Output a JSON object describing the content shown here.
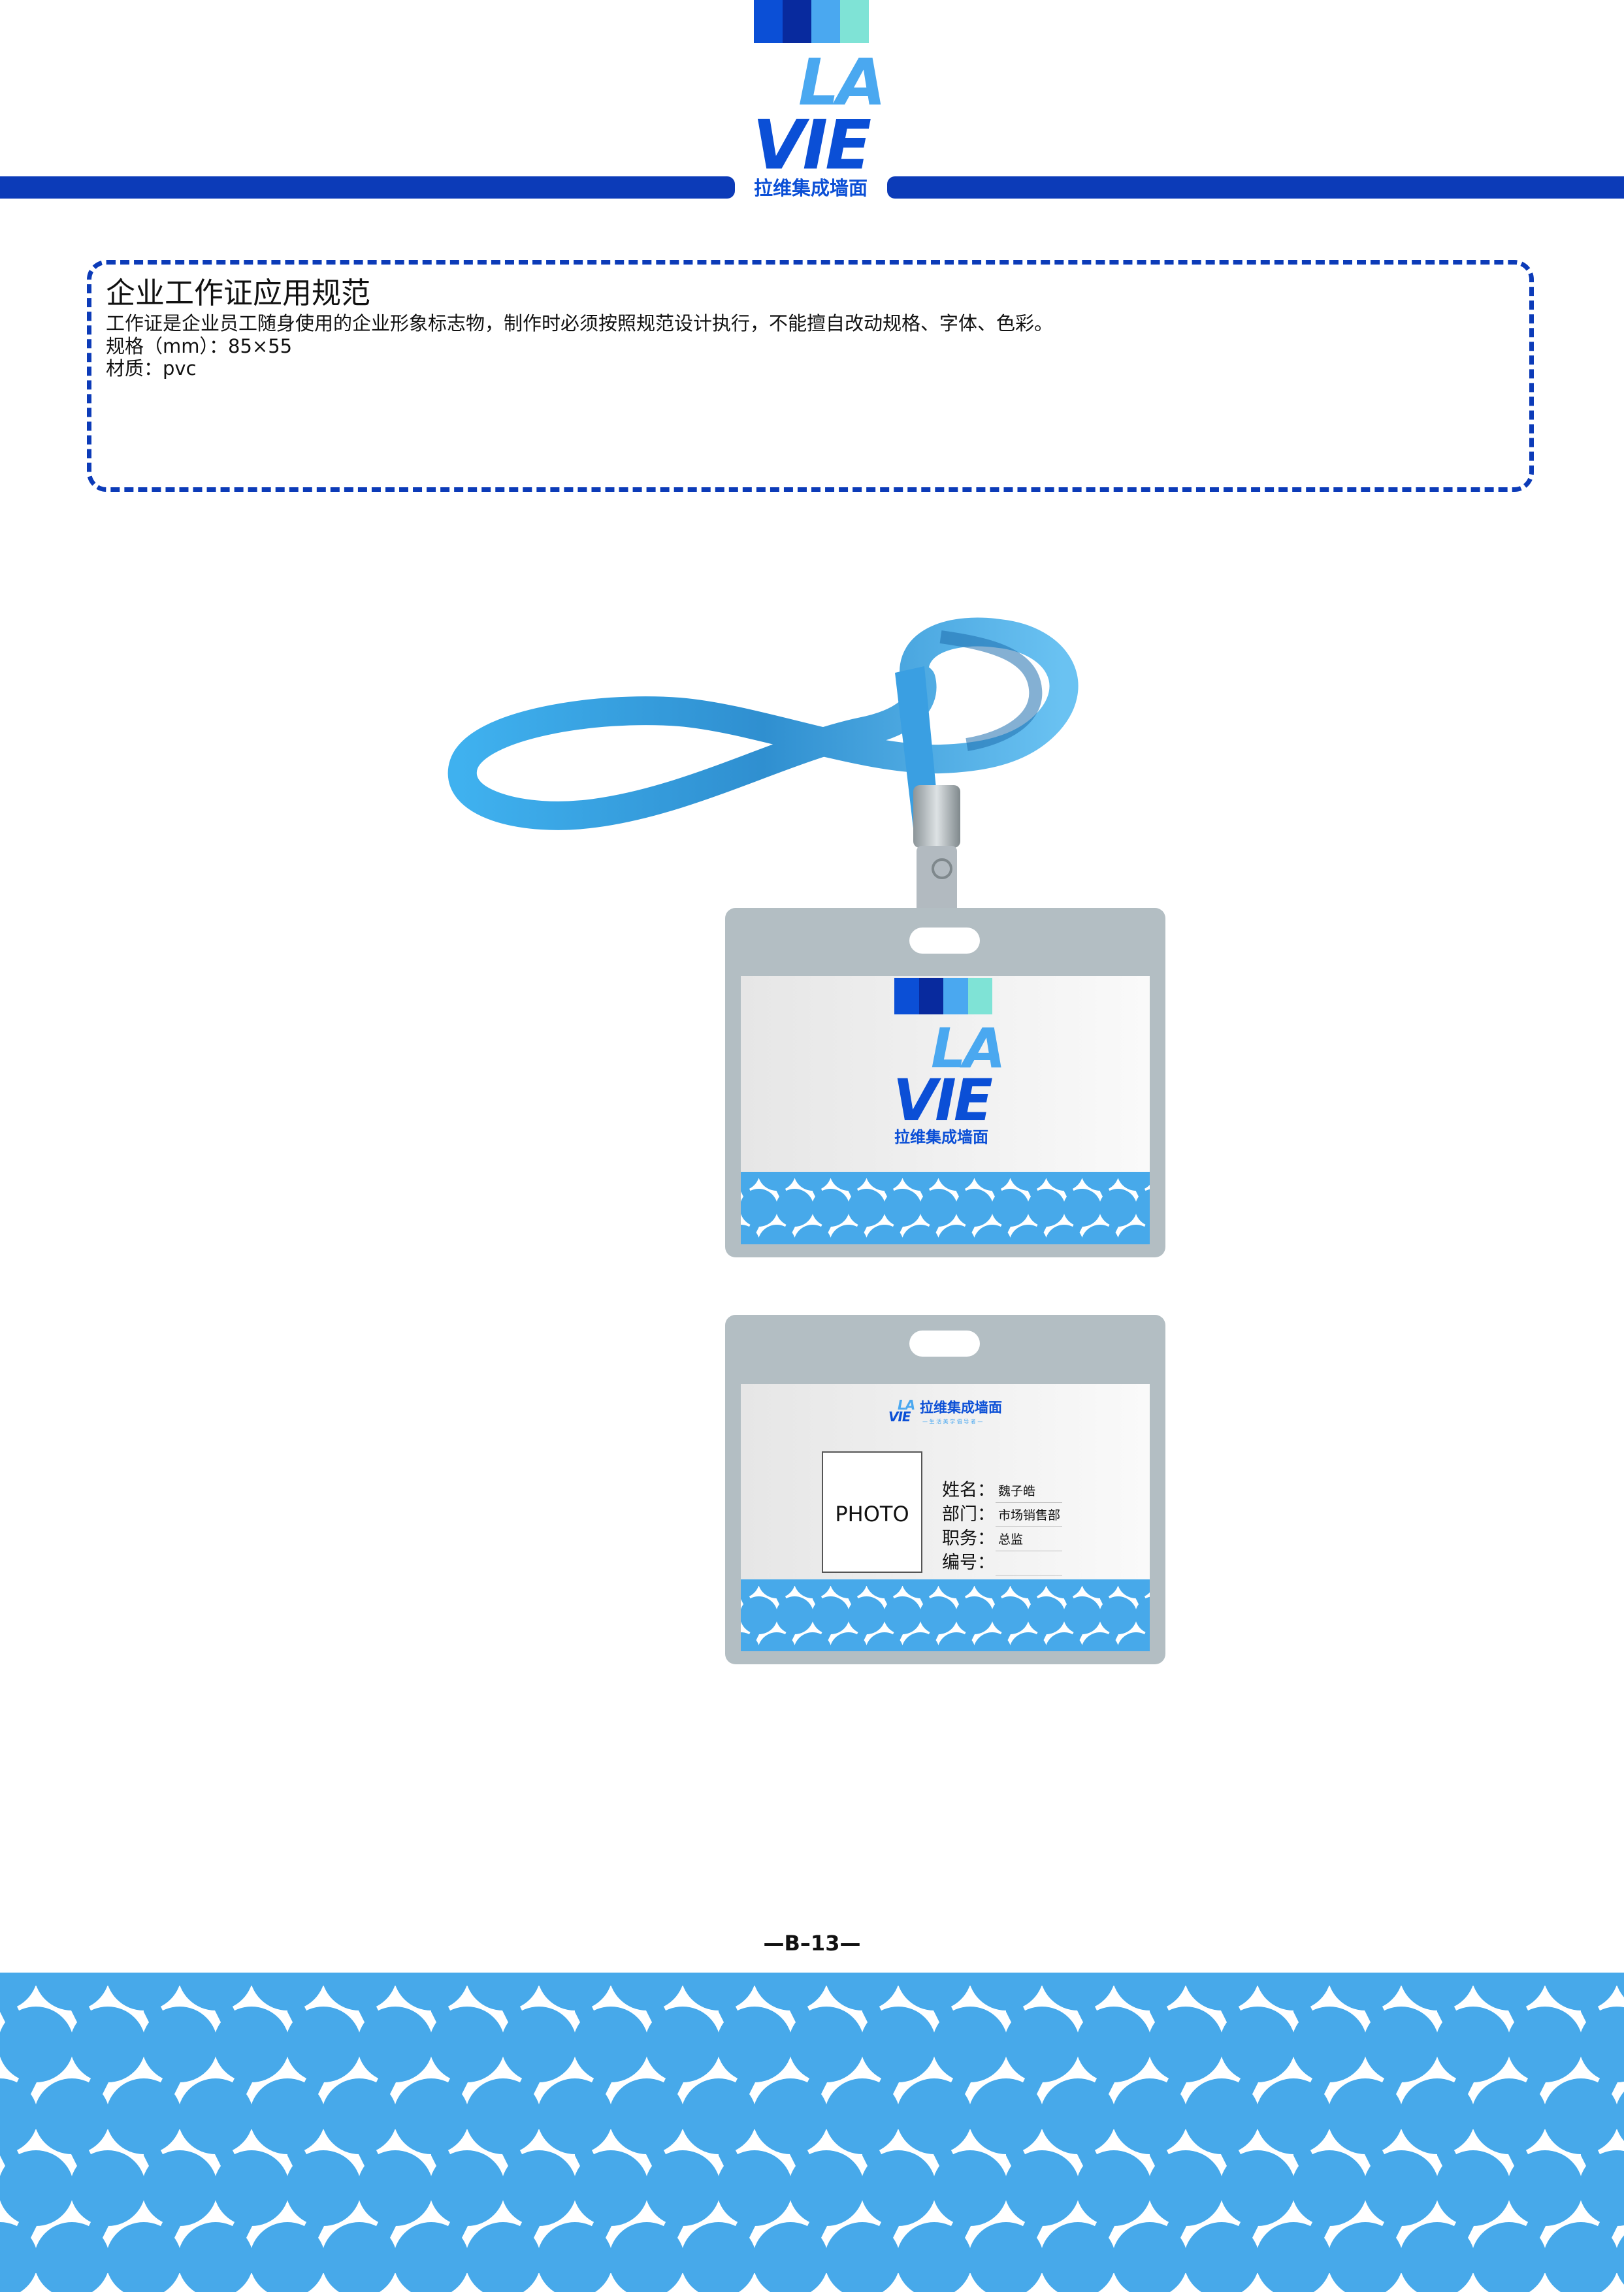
{
  "brand": {
    "logo_line1": "LA",
    "logo_line2": "VIE",
    "logo_cn": "拉维集成墙面",
    "slogan": "— 生 活 美 学 倡 导 者 —",
    "colors": [
      "#0b4fd6",
      "#082a9e",
      "#4aa8f0",
      "#7fe3d6"
    ],
    "primary_color": "#0c3bb8",
    "pattern_color": "#47a9ea"
  },
  "spec": {
    "title": "企业工作证应用规范",
    "line1": "工作证是企业员工随身使用的企业形象标志物，制作时必须按照规范设计执行，不能擅自改动规格、字体、色彩。",
    "line2": "规格（mm）：85×55",
    "line3": "材质：pvc"
  },
  "badge_back": {
    "photo_label": "PHOTO",
    "fields": [
      {
        "label": "姓名：",
        "value": "魏子皓"
      },
      {
        "label": "部门：",
        "value": "市场销售部"
      },
      {
        "label": "职务：",
        "value": "总监"
      },
      {
        "label": "编号：",
        "value": ""
      }
    ]
  },
  "footer": {
    "page_number": "—B–13—"
  }
}
